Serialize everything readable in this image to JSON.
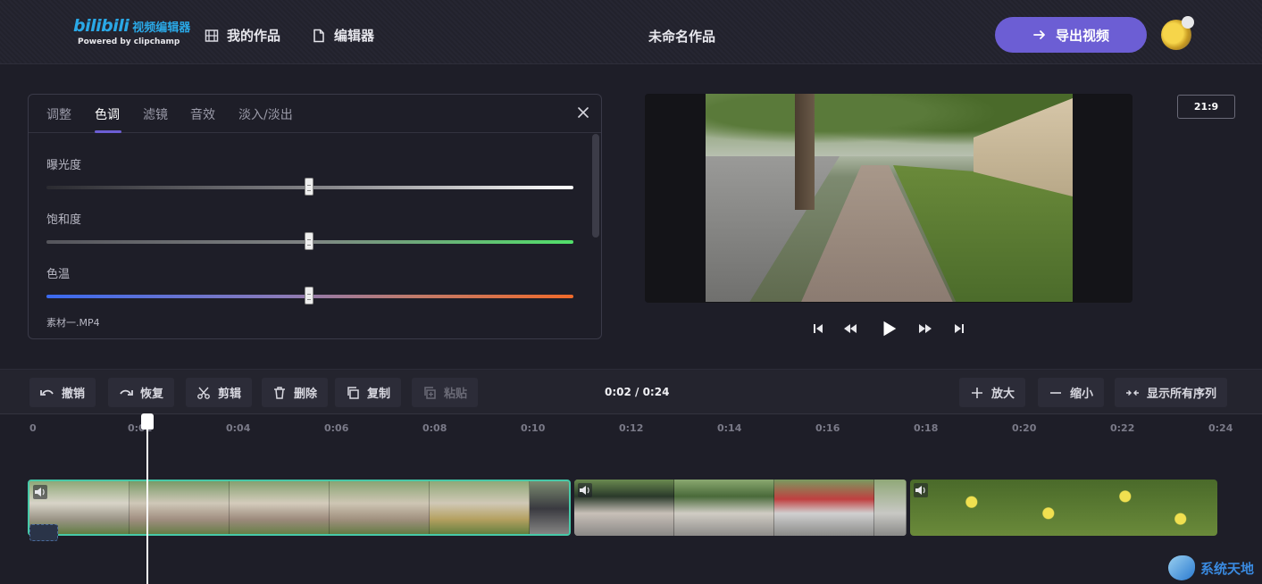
{
  "header": {
    "logo_brand": "bilibili",
    "logo_sub": "视频编辑器",
    "logo_powered": "Powered by clipchamp",
    "nav_works": "我的作品",
    "nav_editor": "编辑器",
    "project_title": "未命名作品",
    "export_label": "导出视频"
  },
  "panel": {
    "tabs": [
      "调整",
      "色调",
      "滤镜",
      "音效",
      "淡入/淡出"
    ],
    "active_tab": "色调",
    "sliders": [
      {
        "label": "曝光度",
        "value": 0.5
      },
      {
        "label": "饱和度",
        "value": 0.5
      },
      {
        "label": "色温",
        "value": 0.5
      }
    ],
    "clip_name": "素材一.MP4"
  },
  "preview": {
    "aspect_ratio": "21:9"
  },
  "toolbar": {
    "undo": "撤销",
    "redo": "恢复",
    "cut": "剪辑",
    "delete": "删除",
    "copy": "复制",
    "paste": "粘贴",
    "timecode": "0:02 / 0:24",
    "zoom_in": "放大",
    "zoom_out": "缩小",
    "show_all": "显示所有序列"
  },
  "timeline": {
    "ruler": [
      "0",
      "0:02",
      "0:04",
      "0:06",
      "0:08",
      "0:10",
      "0:12",
      "0:14",
      "0:16",
      "0:18",
      "0:20",
      "0:22",
      "0:24"
    ],
    "playhead_time": "0:02"
  },
  "watermark": {
    "text": "系统天地"
  },
  "colors": {
    "accent": "#6c5ed4",
    "clip_selected_border": "#47c9a8",
    "logo_blue": "#2aa8e6"
  }
}
